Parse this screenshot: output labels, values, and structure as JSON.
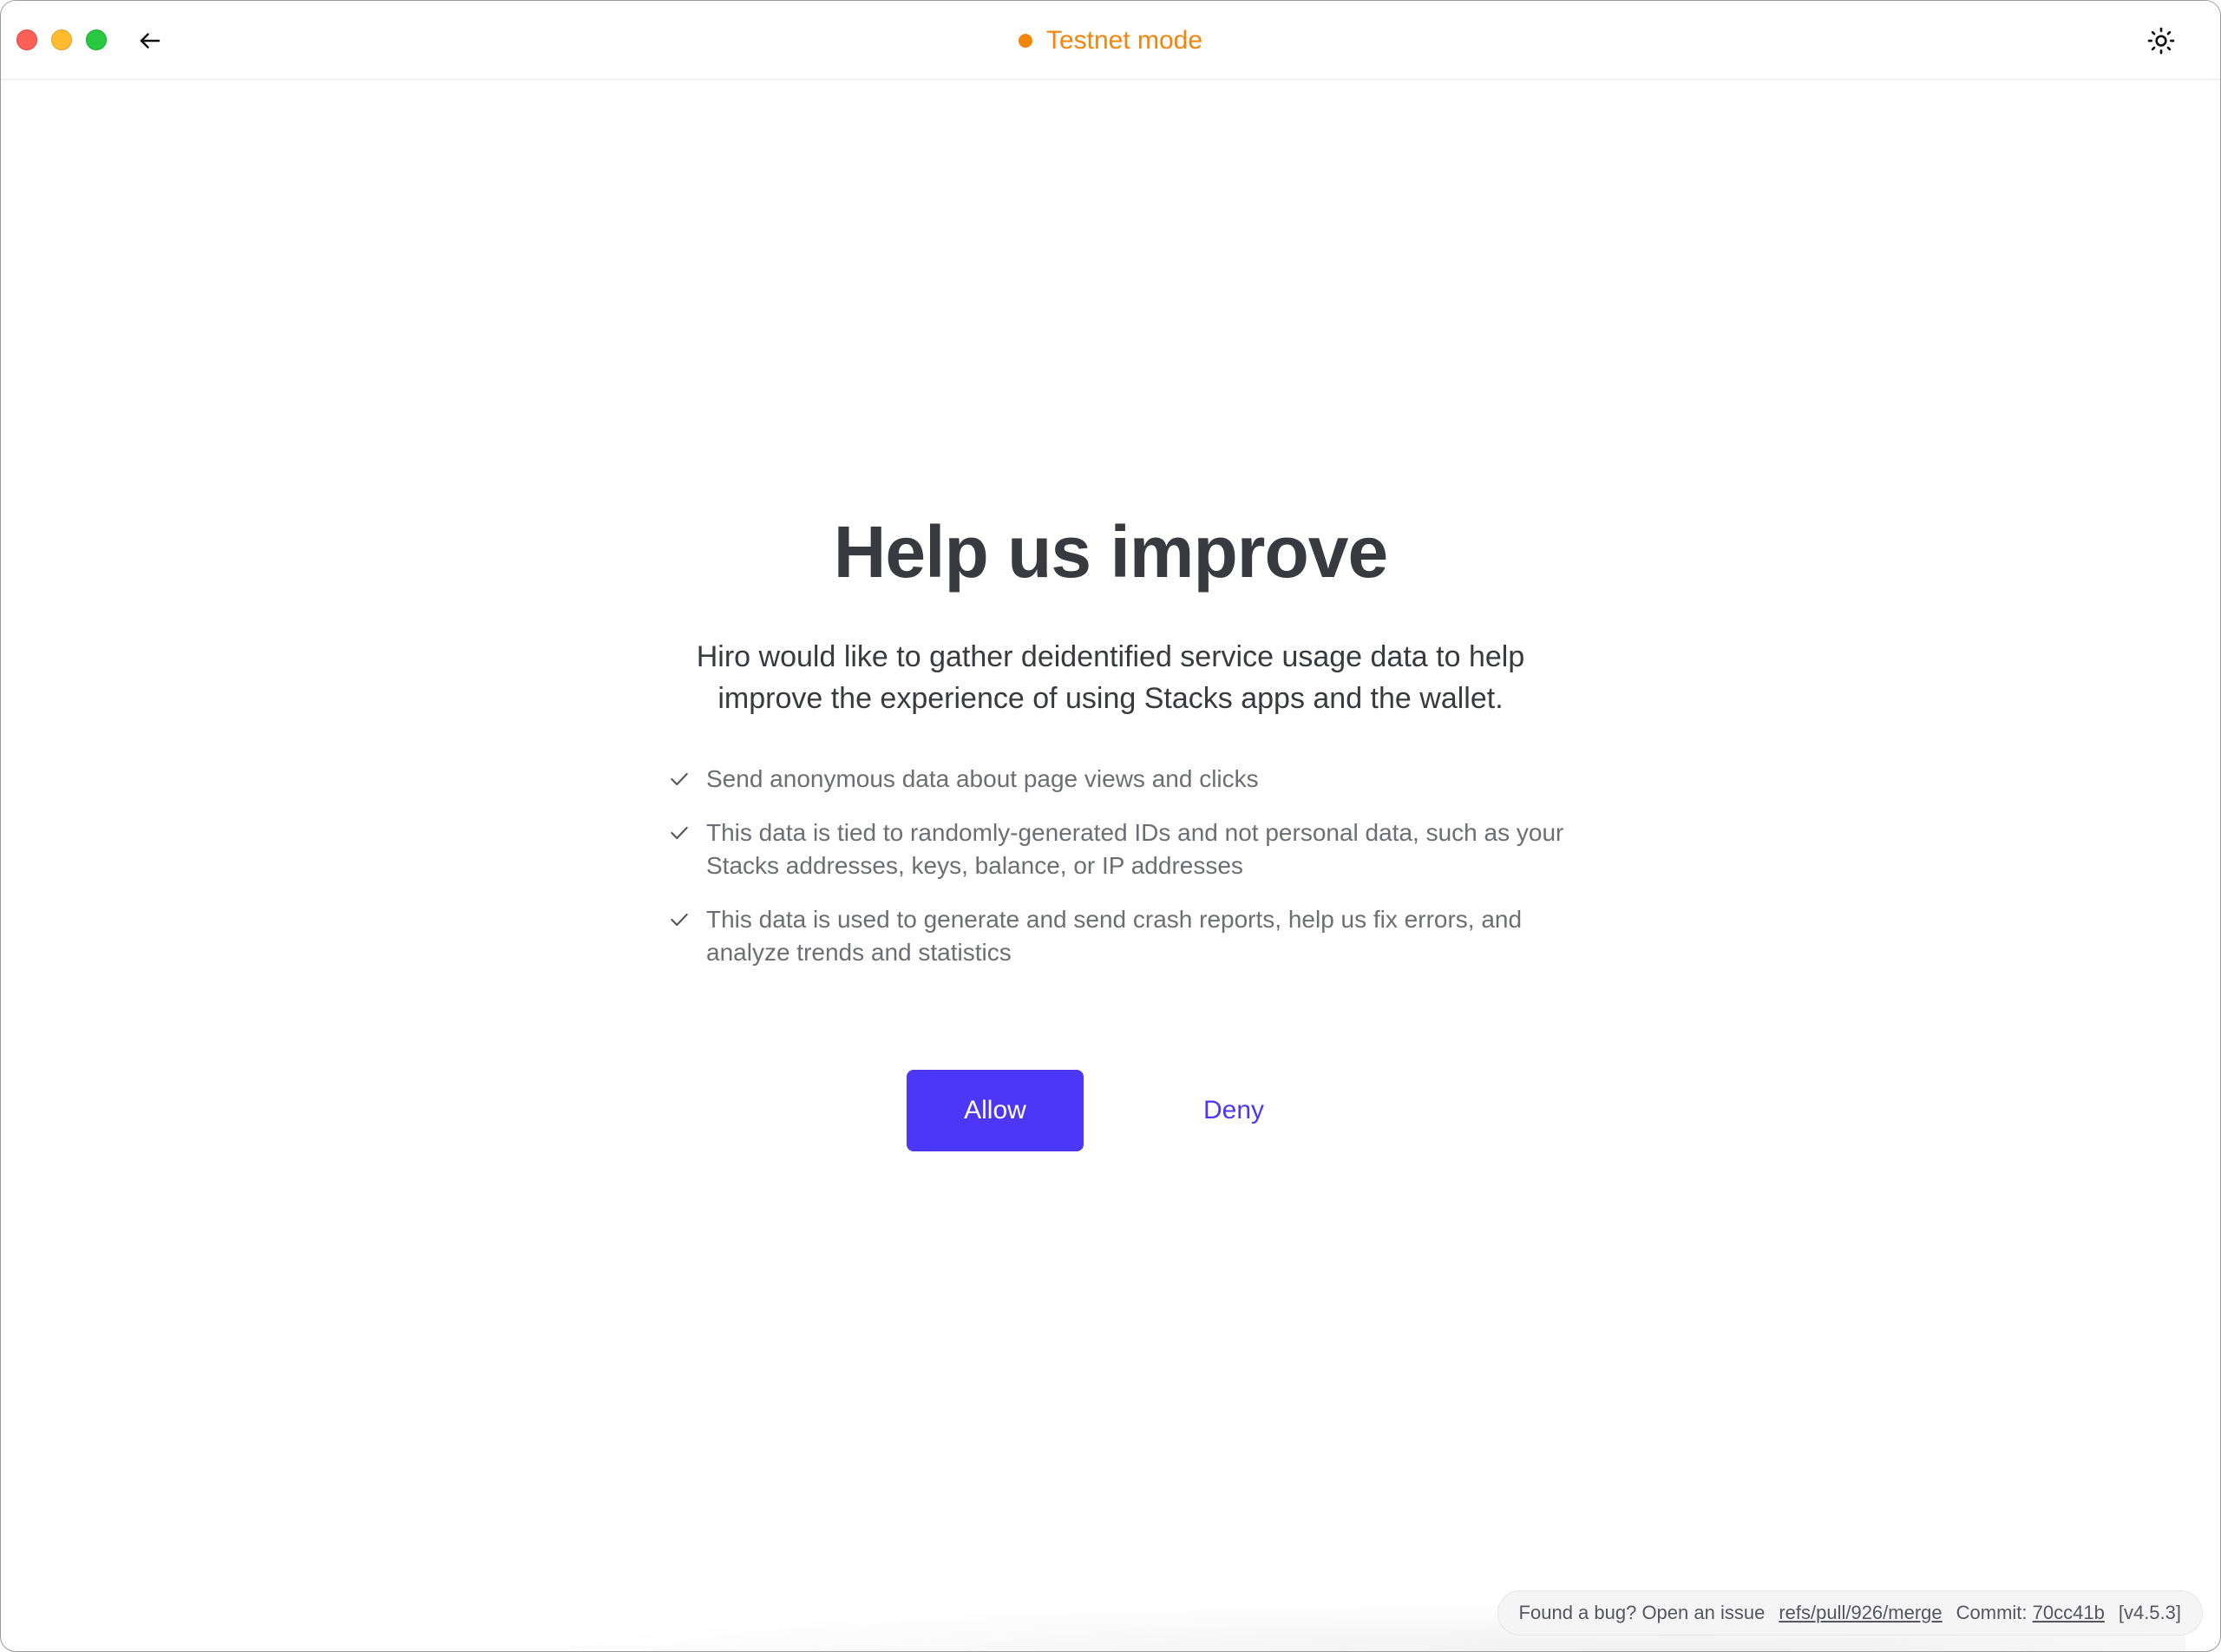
{
  "titlebar": {
    "network_label": "Testnet mode",
    "network_color": "#f4850c",
    "back_icon": "arrow-left-icon",
    "theme_icon": "sun-icon"
  },
  "main": {
    "title": "Help us improve",
    "lead": "Hiro would like to gather deidentified service usage data to help improve the experience of using Stacks apps and the wallet.",
    "bullets": [
      {
        "icon": "check-icon",
        "text": "Send anonymous data about page views and clicks"
      },
      {
        "icon": "check-icon",
        "text": "This data is tied to randomly-generated IDs and not personal data, such as your Stacks addresses, keys, balance, or IP addresses"
      },
      {
        "icon": "check-icon",
        "text": "This data is used to generate and send crash reports, help us fix errors, and analyze trends and statistics"
      }
    ],
    "allow_label": "Allow",
    "deny_label": "Deny",
    "accent_color": "#4b37f5"
  },
  "footer": {
    "bug_text": "Found a bug? Open an issue",
    "branch": "refs/pull/926/merge",
    "commit_label": "Commit:",
    "commit_hash": "70cc41b",
    "version": "[v4.5.3]"
  }
}
